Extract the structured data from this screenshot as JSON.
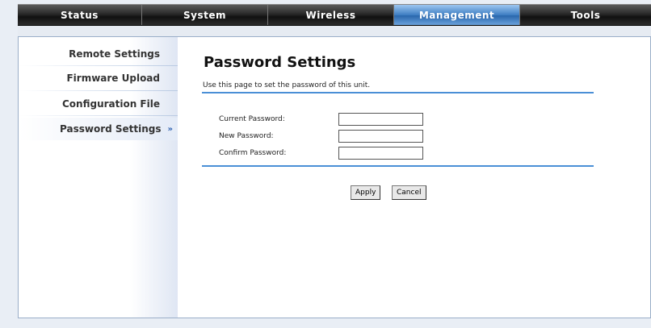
{
  "nav": {
    "tabs": [
      {
        "label": "Status"
      },
      {
        "label": "System"
      },
      {
        "label": "Wireless"
      },
      {
        "label": "Management"
      },
      {
        "label": "Tools"
      }
    ],
    "active_tab": "Management",
    "active_color": "#3f7fc3"
  },
  "sidebar": {
    "items": [
      {
        "label": "Remote Settings"
      },
      {
        "label": "Firmware Upload"
      },
      {
        "label": "Configuration File"
      },
      {
        "label": "Password Settings"
      }
    ],
    "active_item": "Password Settings",
    "active_marker": "»"
  },
  "page": {
    "title": "Password Settings",
    "description": "Use this page to set the password of this unit."
  },
  "form": {
    "current_password_label": "Current Password:",
    "current_password_value": "",
    "new_password_label": "New Password:",
    "new_password_value": "",
    "confirm_password_label": "Confirm Password:",
    "confirm_password_value": ""
  },
  "buttons": {
    "apply": "Apply",
    "cancel": "Cancel"
  },
  "colors": {
    "divider": "#4a8fd6",
    "sidebar_arrow": "#2f62b0"
  }
}
